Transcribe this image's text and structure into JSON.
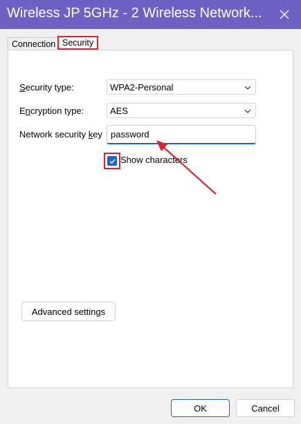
{
  "window": {
    "title": "Wireless JP 5GHz - 2 Wireless Network..."
  },
  "tabs": [
    {
      "label": "Connection"
    },
    {
      "label": "Security"
    }
  ],
  "security": {
    "security_type_label_accel": "S",
    "security_type_label_rest": "ecurity type:",
    "security_type_value": "WPA2-Personal",
    "encryption_type_label_pre": "E",
    "encryption_type_label_accel": "n",
    "encryption_type_label_rest": "cryption type:",
    "encryption_type_value": "AES",
    "key_label_pre": "Network security ",
    "key_label_accel": "k",
    "key_label_rest": "ey",
    "key_value": "password",
    "show_characters_accel": "S",
    "show_characters_rest": "how characters",
    "show_characters_checked": true,
    "advanced_label_pre": "A",
    "advanced_label_accel": "d",
    "advanced_label_rest": "vanced settings"
  },
  "footer": {
    "ok_label": "OK",
    "cancel_label": "Cancel"
  },
  "colors": {
    "titlebar": "#6b62c4",
    "accent": "#1f63c9",
    "highlight": "#d9232f"
  },
  "icons": {
    "close": "close-icon",
    "chevron": "chevron-down-icon",
    "check": "check-icon"
  }
}
